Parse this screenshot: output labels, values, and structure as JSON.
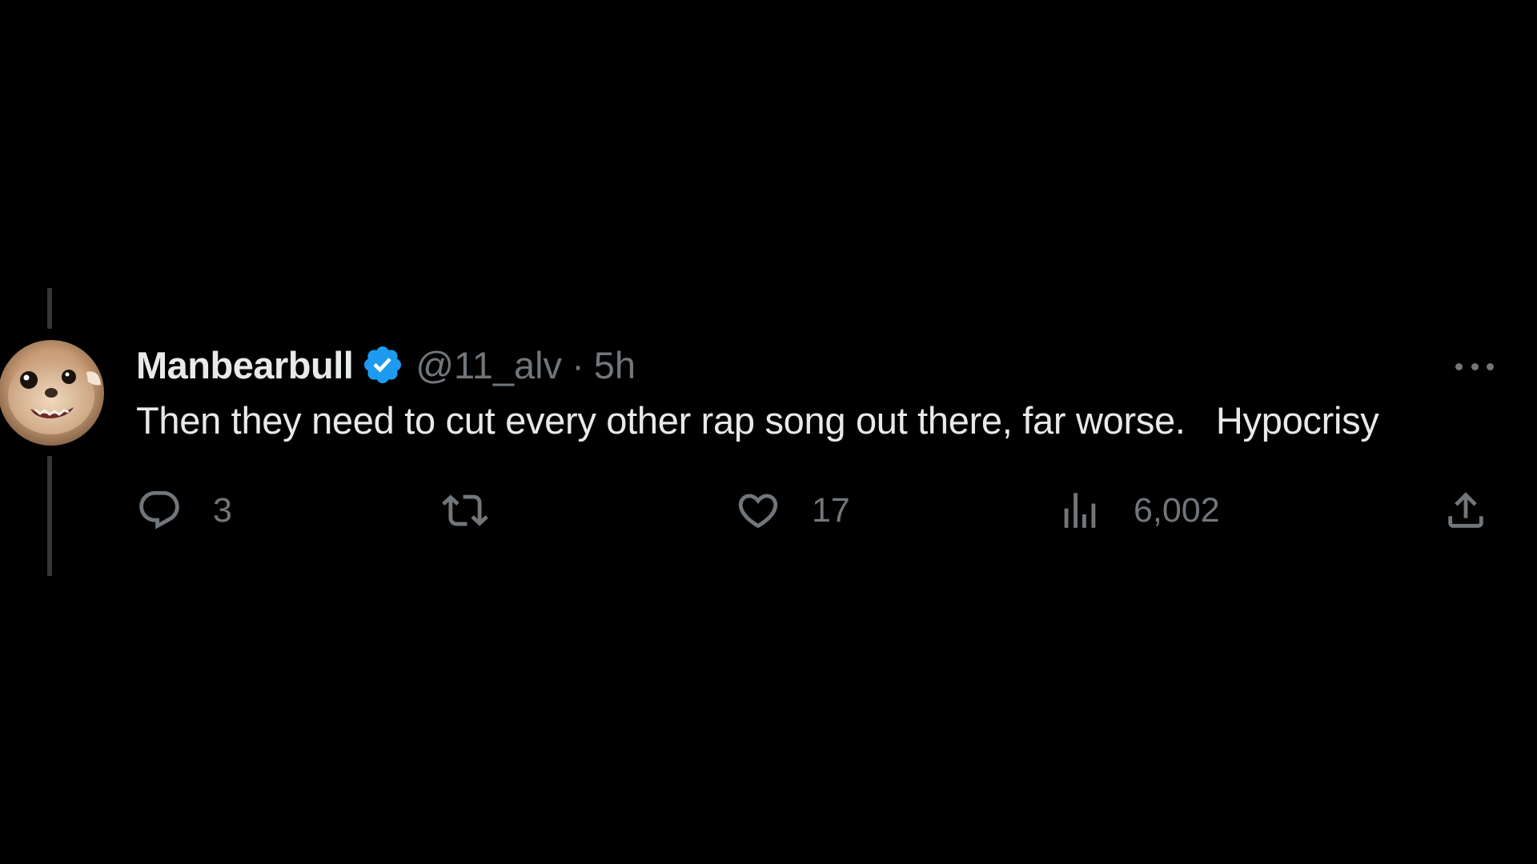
{
  "tweet": {
    "display_name": "Manbearbull",
    "handle": "@11_alv",
    "separator": "·",
    "time": "5h",
    "text": "Then they need to cut every other rap song out there, far worse.   Hypocrisy",
    "verified": true
  },
  "actions": {
    "reply_count": "3",
    "retweet_count": "",
    "like_count": "17",
    "view_count": "6,002"
  },
  "icons": {
    "verified": "verified-badge-icon",
    "more": "more-horizontal-icon",
    "reply": "reply-icon",
    "retweet": "retweet-icon",
    "like": "heart-icon",
    "views": "views-chart-icon",
    "share": "share-icon"
  },
  "colors": {
    "background": "#000000",
    "primary_text": "#e7e9ea",
    "secondary_text": "#71767b",
    "verified_blue": "#1d9bf0",
    "thread_line": "#333639"
  }
}
